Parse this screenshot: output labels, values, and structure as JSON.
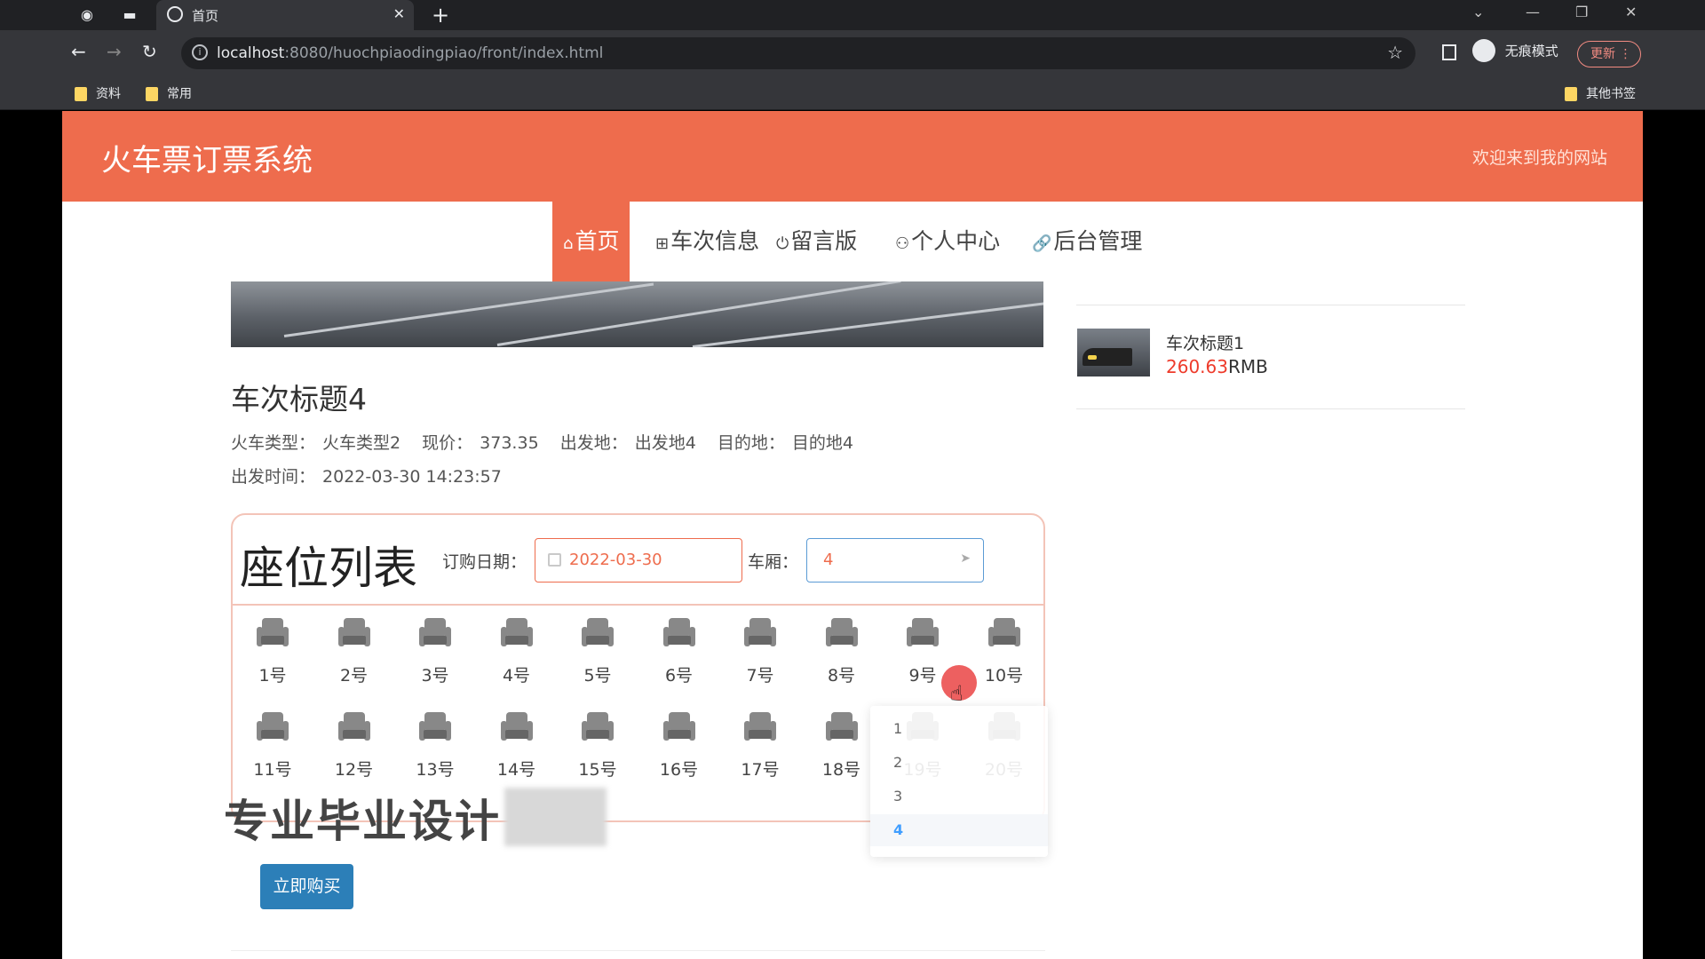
{
  "browser": {
    "tab_title": "首页",
    "url_host": "localhost",
    "url_rest": ":8080/huochpiaodingpiao/front/index.html",
    "incognito_label": "无痕模式",
    "update_label": "更新",
    "bookmarks": [
      "资料",
      "常用"
    ],
    "other_bookmarks": "其他书签"
  },
  "header": {
    "site_title": "火车票订票系统",
    "welcome": "欢迎来到我的网站"
  },
  "nav": {
    "items": [
      {
        "icon": "⌂",
        "label": "首页"
      },
      {
        "icon": "⊞",
        "label": "车次信息"
      },
      {
        "icon": "⏻",
        "label": "留言版"
      },
      {
        "icon": "⚇",
        "label": "个人中心"
      },
      {
        "icon": "🔗",
        "label": "后台管理"
      }
    ]
  },
  "train": {
    "title": "车次标题4",
    "type_label": "火车类型：",
    "type_value": "火车类型2",
    "price_label": "现价：",
    "price_value": "373.35",
    "from_label": "出发地：",
    "from_value": "出发地4",
    "to_label": "目的地：",
    "to_value": "目的地4",
    "depart_label": "出发时间：",
    "depart_value": "2022-03-30 14:23:57"
  },
  "seat_panel": {
    "heading": "座位列表",
    "date_label": "订购日期：",
    "date_value": "2022-03-30",
    "car_label": "车厢：",
    "car_value": "4",
    "car_options": [
      "1",
      "2",
      "3",
      "4"
    ],
    "seats": [
      "1号",
      "2号",
      "3号",
      "4号",
      "5号",
      "6号",
      "7号",
      "8号",
      "9号",
      "10号",
      "11号",
      "12号",
      "13号",
      "14号",
      "15号",
      "16号",
      "17号",
      "18号",
      "19号",
      "20号"
    ]
  },
  "watermark": "专业毕业设计",
  "buy_button": "立即购买",
  "sidebar": {
    "items": [
      {
        "title": "车次标题1",
        "price": "260.63",
        "unit": "RMB"
      }
    ]
  },
  "colors": {
    "brand": "#ee6c4d",
    "price": "#ee3b2b",
    "button": "#2c7fb8"
  }
}
